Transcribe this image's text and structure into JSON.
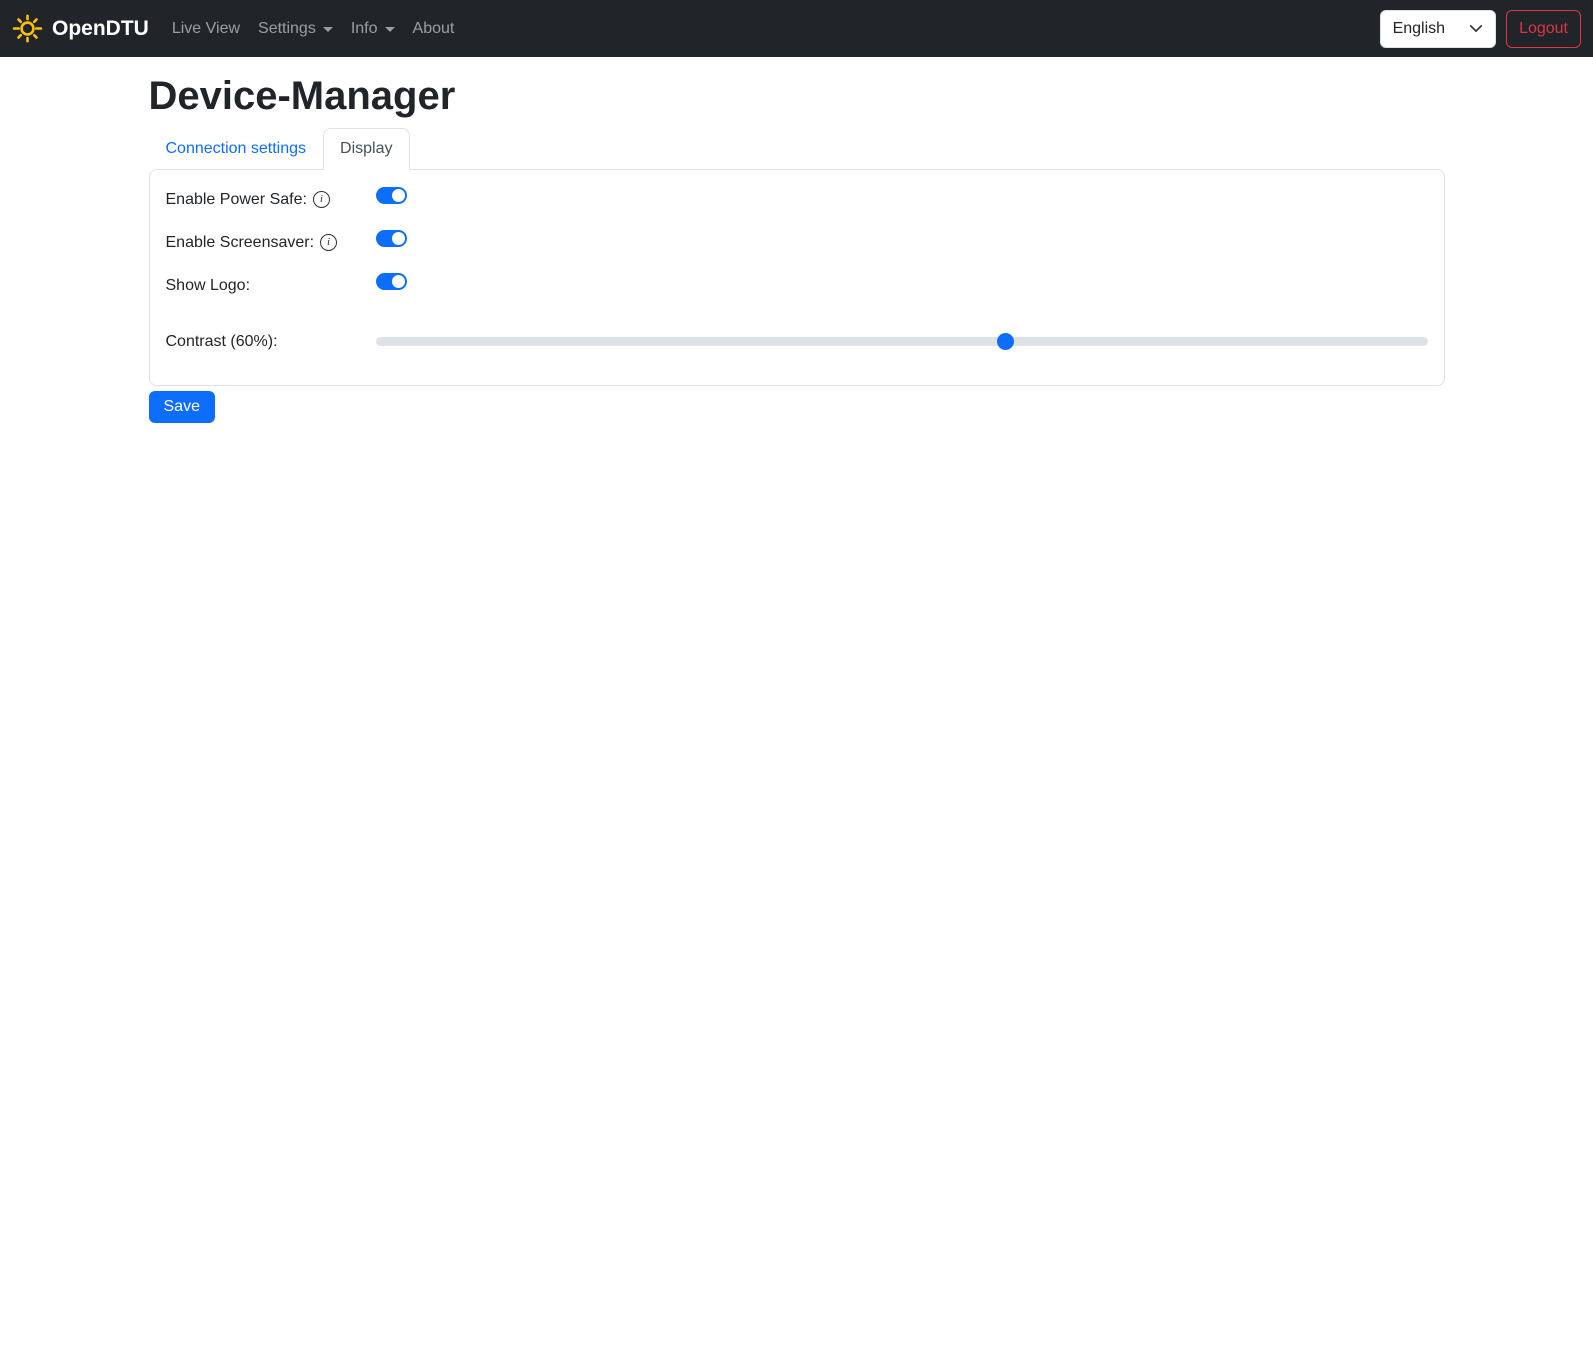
{
  "navbar": {
    "brand": "OpenDTU",
    "live_view": "Live View",
    "settings": "Settings",
    "info": "Info",
    "about": "About",
    "language": "English",
    "logout": "Logout"
  },
  "page": {
    "title": "Device-Manager"
  },
  "tabs": {
    "connection": "Connection settings",
    "display": "Display"
  },
  "settings": {
    "power_safe": {
      "label": "Enable Power Safe:",
      "enabled": true
    },
    "screensaver": {
      "label": "Enable Screensaver:",
      "enabled": true
    },
    "show_logo": {
      "label": "Show Logo:",
      "enabled": true
    },
    "contrast": {
      "label": "Contrast (60%):",
      "value": 60
    }
  },
  "actions": {
    "save": "Save"
  },
  "colors": {
    "primary": "#0d6efd",
    "navbar_bg": "#212529",
    "danger": "#dc3545",
    "sun": "#ffc107",
    "border": "#dee2e6"
  }
}
